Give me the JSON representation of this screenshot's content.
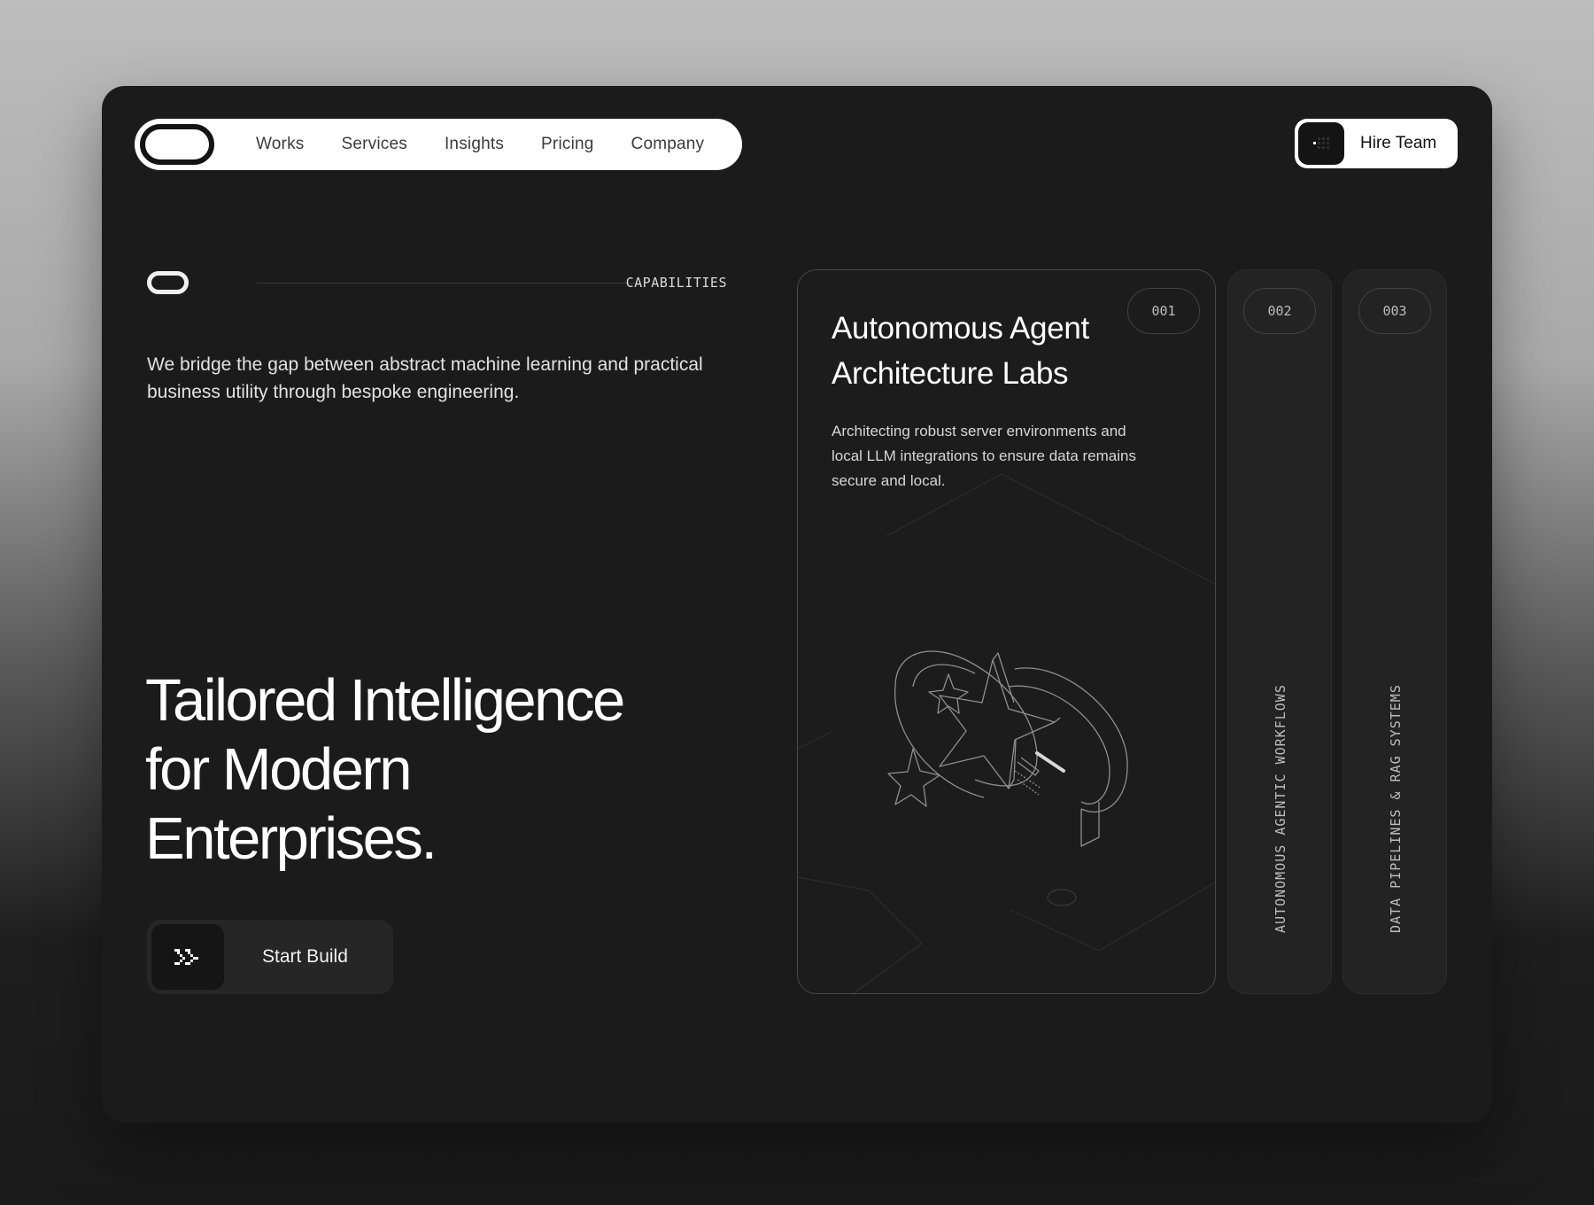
{
  "nav": {
    "links": [
      "Works",
      "Services",
      "Insights",
      "Pricing",
      "Company"
    ],
    "cta_label": "Hire Team"
  },
  "section": {
    "label": "CAPABILITIES",
    "intro": "We bridge the gap between abstract machine learning and practical business utility through bespoke engineering.",
    "hero_lines": [
      "Tailored Intelligence",
      "for Modern",
      "Enterprises."
    ],
    "cta_label": "Start Build"
  },
  "cards": [
    {
      "number": "001",
      "title": "Autonomous Agent Architecture Labs",
      "description": "Architecting robust server environments and local LLM integrations to ensure data remains secure and local."
    },
    {
      "number": "002",
      "vertical_label": "AUTONOMOUS AGENTIC WORKFLOWS"
    },
    {
      "number": "003",
      "vertical_label": "DATA PIPELINES & RAG SYSTEMS"
    }
  ],
  "icons": {
    "logo": "pill-logo-icon",
    "hire": "pixel-grid-icon",
    "start": "double-chevron-right-icon",
    "illustration": "isometric-star-medal-icon"
  }
}
